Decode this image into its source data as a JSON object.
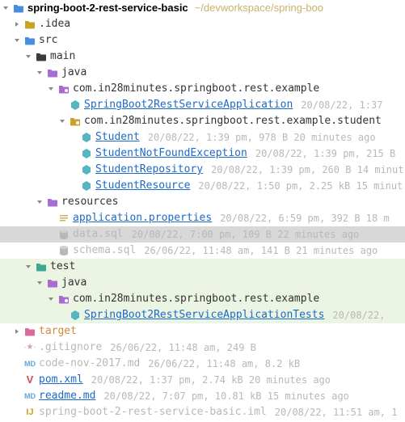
{
  "root": {
    "name": "spring-boot-2-rest-service-basic",
    "path": "~/devworkspace/spring-boo"
  },
  "idea": ".idea",
  "src": "src",
  "main": "main",
  "java": "java",
  "pkg_example": "com.in28minutes.springboot.rest.example",
  "app_class": {
    "name": "SpringBoot2RestServiceApplication",
    "meta": "20/08/22, 1:37"
  },
  "pkg_student": "com.in28minutes.springboot.rest.example.student",
  "student": {
    "name": "Student",
    "meta": "20/08/22, 1:39 pm, 978 B 20 minutes ago"
  },
  "student_nf": {
    "name": "StudentNotFoundException",
    "meta": "20/08/22, 1:39 pm, 215 B"
  },
  "student_repo": {
    "name": "StudentRepository",
    "meta": "20/08/22, 1:39 pm, 260 B 14 minut"
  },
  "student_res": {
    "name": "StudentResource",
    "meta": "20/08/22, 1:50 pm, 2.25 kB 15 minut"
  },
  "resources": "resources",
  "app_props": {
    "name": "application.properties",
    "meta": "20/08/22, 6:59 pm, 392 B 18 m"
  },
  "data_sql": {
    "name": "data.sql",
    "meta": "20/08/22, 7:00 pm, 109 B 22 minutes ago"
  },
  "schema_sql": {
    "name": "schema.sql",
    "meta": "26/06/22, 11:48 am, 141 B 21 minutes ago"
  },
  "test": "test",
  "test_java": "java",
  "pkg_test": "com.in28minutes.springboot.rest.example",
  "test_class": {
    "name": "SpringBoot2RestServiceApplicationTests",
    "meta": "20/08/22,"
  },
  "target": "target",
  "gitignore": {
    "name": ".gitignore",
    "meta": "26/06/22, 11:48 am, 249 B"
  },
  "code_md": {
    "name": "code-nov-2017.md",
    "meta": "26/06/22, 11:48 am, 8.2 kB"
  },
  "pom": {
    "name": "pom.xml",
    "meta": "20/08/22, 1:37 pm, 2.74 kB 20 minutes ago"
  },
  "readme": {
    "name": "readme.md",
    "meta": "20/08/22, 7:07 pm, 10.81 kB 15 minutes ago"
  },
  "iml": {
    "name": "spring-boot-2-rest-service-basic.iml",
    "meta": "20/08/22, 11:51 am, 1"
  }
}
